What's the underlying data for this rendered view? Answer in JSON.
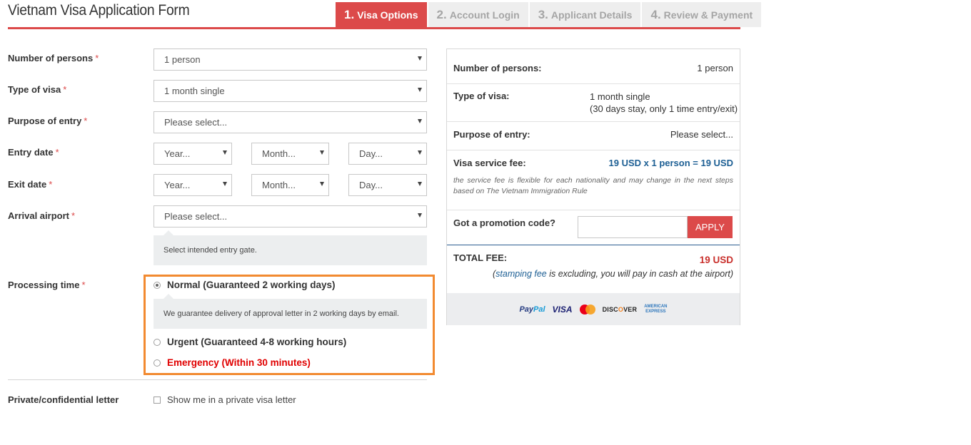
{
  "header": {
    "title": "Vietnam Visa Application Form",
    "steps": [
      {
        "num": "1.",
        "label": "Visa Options",
        "active": true
      },
      {
        "num": "2.",
        "label": "Account Login",
        "active": false
      },
      {
        "num": "3.",
        "label": "Applicant Details",
        "active": false
      },
      {
        "num": "4.",
        "label": "Review & Payment",
        "active": false
      }
    ]
  },
  "form": {
    "required_mark": "*",
    "number_of_persons": {
      "label": "Number of persons",
      "value": "1 person"
    },
    "type_of_visa": {
      "label": "Type of visa",
      "value": "1 month single"
    },
    "purpose_of_entry": {
      "label": "Purpose of entry",
      "value": "Please select..."
    },
    "entry_date": {
      "label": "Entry date",
      "year": "Year...",
      "month": "Month...",
      "day": "Day..."
    },
    "exit_date": {
      "label": "Exit date",
      "year": "Year...",
      "month": "Month...",
      "day": "Day..."
    },
    "arrival_airport": {
      "label": "Arrival airport",
      "value": "Please select...",
      "hint": "Select intended entry gate."
    },
    "processing_time": {
      "label": "Processing time",
      "options": [
        {
          "label": "Normal (Guaranteed 2 working days)",
          "checked": true
        },
        {
          "label": "Urgent (Guaranteed 4-8 working hours)",
          "checked": false
        },
        {
          "label": "Emergency (Within 30 minutes)",
          "checked": false
        }
      ],
      "normal_note": "We guarantee delivery of approval letter in 2 working days by email."
    },
    "private_letter": {
      "label": "Private/confidential letter",
      "checkbox_label": "Show me in a private visa letter",
      "checked": false
    }
  },
  "summary": {
    "persons_label": "Number of persons:",
    "persons_value": "1 person",
    "visa_label": "Type of visa:",
    "visa_value_line1": "1 month single",
    "visa_value_line2": "(30 days stay, only 1 time entry/exit)",
    "purpose_label": "Purpose of entry:",
    "purpose_value": "Please select...",
    "fee_label": "Visa service fee:",
    "fee_value": "19 USD x 1 person = 19 USD",
    "fee_note": "the service fee is flexible for each nationality and may change in the next steps based on The Vietnam Immigration Rule",
    "promo_label": "Got a promotion code?",
    "promo_button": "APPLY",
    "total_label": "TOTAL FEE:",
    "total_value": "19 USD",
    "stamp_open": "(",
    "stamp_link": "stamping fee",
    "stamp_rest": " is excluding, you will pay in cash at the airport)",
    "payment_logos": {
      "paypal_a": "Pay",
      "paypal_b": "Pal",
      "visa": "VISA",
      "discover_a": "DISC",
      "discover_b": "O",
      "discover_c": "VER",
      "amex_a": "AMERICAN",
      "amex_b": "EXPRESS"
    }
  }
}
